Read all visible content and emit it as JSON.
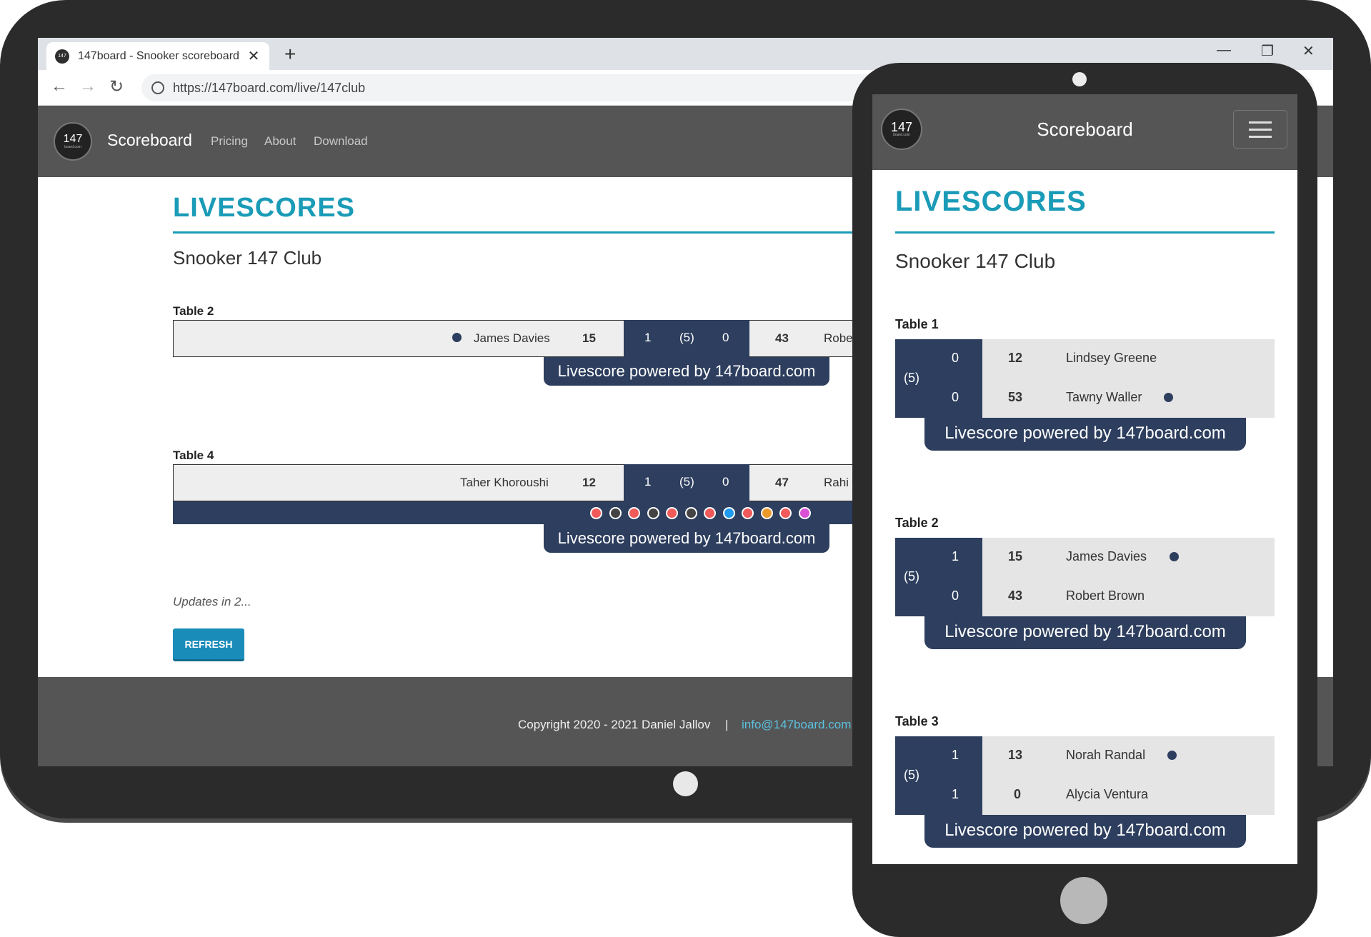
{
  "browser": {
    "tab_title": "147board - Snooker scoreboard",
    "url": "https://147board.com/live/147club"
  },
  "site": {
    "logo_text": "147",
    "logo_sub": "board.com",
    "brand": "Scoreboard",
    "nav": [
      "Pricing",
      "About",
      "Download"
    ],
    "heading": "LIVESCORES",
    "club": "Snooker 147 Club",
    "powered": "Livescore powered by 147board.com",
    "updates": "Updates in 2...",
    "refresh": "REFRESH",
    "copyright": "Copyright 2020 - 2021 Daniel Jallov",
    "separator": "|",
    "email": "info@147board.com"
  },
  "desktop_tables": [
    {
      "label": "Table 2",
      "player1": "James Davies",
      "score1": "15",
      "frames1": "1",
      "best_of": "(5)",
      "frames2": "0",
      "score2": "43",
      "player2_visible": "Robe"
    },
    {
      "label": "Table 4",
      "player1": "Taher Khoroushi",
      "score1": "12",
      "frames1": "1",
      "best_of": "(5)",
      "frames2": "0",
      "score2": "47",
      "player2_visible": "Rahi",
      "balls": [
        "#f15a5a",
        "#444444",
        "#f15a5a",
        "#444444",
        "#f15a5a",
        "#444444",
        "#f15a5a",
        "#1e9bf0",
        "#f15a5a",
        "#e99a2a",
        "#f15a5a",
        "#d94fd6"
      ]
    }
  ],
  "mobile_tables": [
    {
      "label": "Table 1",
      "best_of": "(5)",
      "frames1": "0",
      "frames2": "0",
      "score1": "12",
      "score2": "53",
      "player1": "Lindsey Greene",
      "player2": "Tawny Waller"
    },
    {
      "label": "Table 2",
      "best_of": "(5)",
      "frames1": "1",
      "frames2": "0",
      "score1": "15",
      "score2": "43",
      "player1": "James Davies",
      "player2": "Robert Brown"
    },
    {
      "label": "Table 3",
      "best_of": "(5)",
      "frames1": "1",
      "frames2": "1",
      "score1": "13",
      "score2": "0",
      "player1": "Norah Randal",
      "player2": "Alycia Ventura"
    }
  ],
  "colors": {
    "accent": "#1a9bb7",
    "navy": "#2d3e5e",
    "navbar": "#555555"
  }
}
